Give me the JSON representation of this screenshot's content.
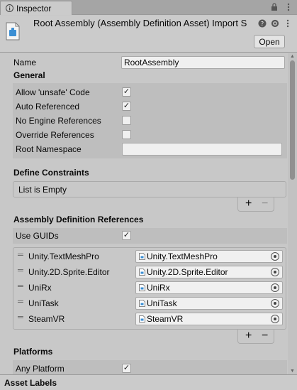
{
  "tab": {
    "label": "Inspector",
    "icon": "info-icon"
  },
  "tab_tools": [
    "lock-icon",
    "menu-dots-icon"
  ],
  "header": {
    "title": "Root Assembly (Assembly Definition Asset) Import S",
    "icon": "assembly-definition-icon",
    "help_icon": "help-icon",
    "settings_icon": "settings-icon",
    "more_icon": "more-icon",
    "open_label": "Open"
  },
  "name_field": {
    "label": "Name",
    "value": "RootAssembly"
  },
  "general": {
    "title": "General",
    "allow_unsafe": {
      "label": "Allow 'unsafe' Code",
      "checked": true
    },
    "auto_referenced": {
      "label": "Auto Referenced",
      "checked": true
    },
    "no_engine_refs": {
      "label": "No Engine References",
      "checked": false
    },
    "override_refs": {
      "label": "Override References",
      "checked": false
    },
    "root_namespace": {
      "label": "Root Namespace",
      "value": ""
    }
  },
  "define_constraints": {
    "title": "Define Constraints",
    "empty_text": "List is Empty"
  },
  "assembly_refs": {
    "title": "Assembly Definition References",
    "use_guids": {
      "label": "Use GUIDs",
      "checked": true
    },
    "items": [
      {
        "label": "Unity.TextMeshPro",
        "value": "Unity.TextMeshPro"
      },
      {
        "label": "Unity.2D.Sprite.Editor",
        "value": "Unity.2D.Sprite.Editor"
      },
      {
        "label": "UniRx",
        "value": "UniRx"
      },
      {
        "label": "UniTask",
        "value": "UniTask"
      },
      {
        "label": "SteamVR",
        "value": "SteamVR"
      }
    ]
  },
  "list_controls": {
    "add": "+",
    "remove": "−"
  },
  "platforms": {
    "title": "Platforms",
    "any_platform": {
      "label": "Any Platform",
      "checked": true
    }
  },
  "footer": {
    "label": "Asset Labels"
  },
  "check_mark": "✓"
}
